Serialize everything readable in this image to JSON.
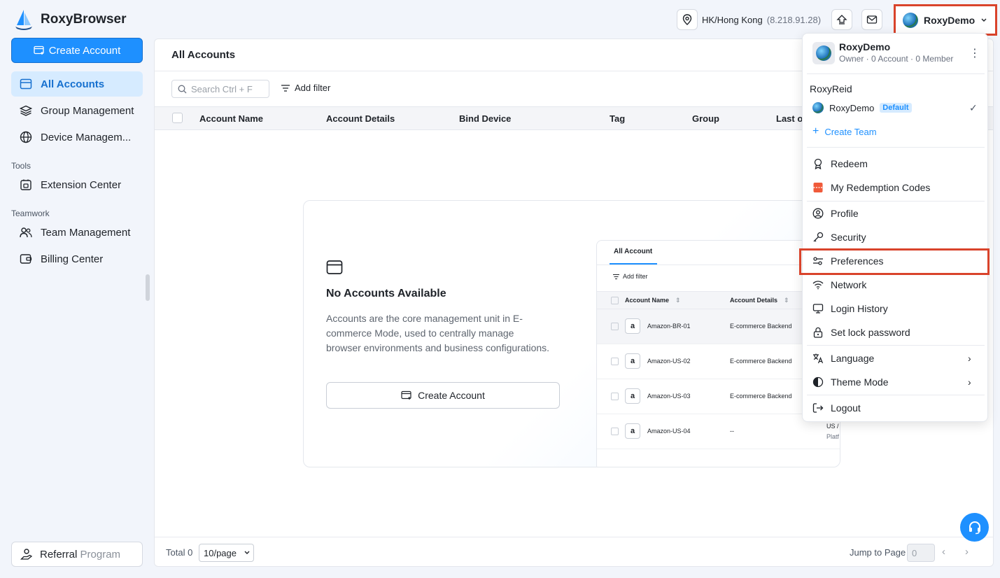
{
  "app": {
    "name": "RoxyBrowser"
  },
  "header": {
    "location_name": "HK/Hong Kong",
    "location_ip": "(8.218.91.28)",
    "user_name": "RoxyDemo"
  },
  "sidebar": {
    "create_label": "Create Account",
    "items": [
      {
        "label": "All Accounts"
      },
      {
        "label": "Group Management"
      },
      {
        "label": "Device Managem..."
      }
    ],
    "tools_title": "Tools",
    "tools_items": [
      {
        "label": "Extension Center"
      }
    ],
    "teamwork_title": "Teamwork",
    "teamwork_items": [
      {
        "label": "Team Management"
      },
      {
        "label": "Billing Center"
      }
    ],
    "referral_a": "Referral",
    "referral_b": "Program"
  },
  "main": {
    "title": "All Accounts",
    "search_placeholder": "Search Ctrl + F",
    "add_filter": "Add filter",
    "columns": [
      "Account Name",
      "Account Details",
      "Bind Device",
      "Tag",
      "Group",
      "Last o"
    ],
    "empty": {
      "title": "No Accounts Available",
      "desc": "Accounts are the core management unit in E-commerce Mode, used to centrally manage browser environments and business configurations.",
      "button": "Create Account"
    },
    "preview": {
      "tab": "All Account",
      "filter": "Add filter",
      "col1": "Account Name",
      "col2": "Account Details",
      "rows": [
        {
          "name": "Amazon-BR-01",
          "details": "E-commerce Backend"
        },
        {
          "name": "Amazon-US-02",
          "details": "E-commerce Backend"
        },
        {
          "name": "Amazon-US-03",
          "details": "E-commerce Backend"
        },
        {
          "name": "Amazon-US-04",
          "details": "--"
        }
      ],
      "side_a": "US /",
      "side_b": "Platf",
      "logo_glyph": "a"
    },
    "footer": {
      "total": "Total 0",
      "per_page": "10/page",
      "jump_label": "Jump to Page",
      "jump_value": "0"
    }
  },
  "dropdown": {
    "name": "RoxyDemo",
    "sub": "Owner · 0 Account · 0 Member",
    "team_title": "RoxyReid",
    "team_name": "RoxyDemo",
    "team_badge": "Default",
    "create_team": "Create Team",
    "items": {
      "redeem": "Redeem",
      "codes": "My Redemption Codes",
      "profile": "Profile",
      "security": "Security",
      "preferences": "Preferences",
      "network": "Network",
      "login_history": "Login History",
      "lock": "Set lock password",
      "language": "Language",
      "theme": "Theme Mode",
      "logout": "Logout"
    }
  },
  "colors": {
    "accent": "#1e90ff",
    "highlight": "#d9432b",
    "active_bg": "#d6ebff"
  }
}
